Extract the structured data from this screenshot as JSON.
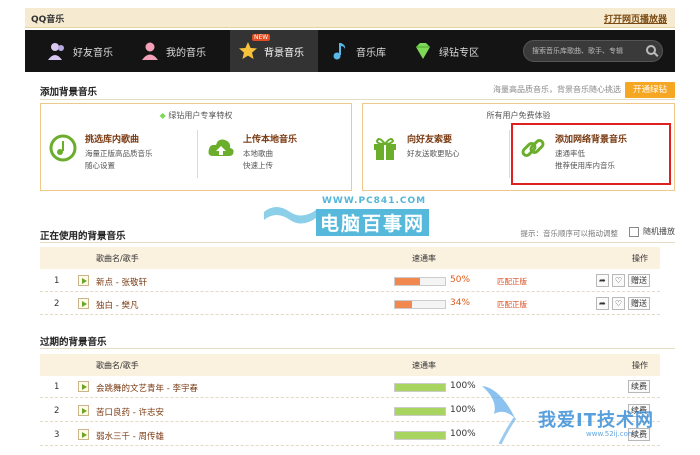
{
  "window": {
    "title": "QQ音乐",
    "open_web_player": "打开网页播放器"
  },
  "nav": {
    "items": [
      {
        "label": "好友音乐",
        "icon": "friends-icon"
      },
      {
        "label": "我的音乐",
        "icon": "person-icon"
      },
      {
        "label": "背景音乐",
        "icon": "star-icon",
        "badge": "NEW",
        "active": true
      },
      {
        "label": "音乐库",
        "icon": "note-icon"
      },
      {
        "label": "绿钻专区",
        "icon": "diamond-icon"
      }
    ],
    "search_placeholder": "搜索音乐库歌曲、歌手、专辑"
  },
  "add_bg": {
    "title": "添加背景音乐",
    "promo": "海量高品质音乐，背景音乐随心挑选",
    "open_btn": "开通绿钻",
    "vip_panel": {
      "header": "绿钻用户专享特权",
      "features": [
        {
          "title": "挑选库内歌曲",
          "lines": [
            "海量正版高品质音乐",
            "随心设置"
          ]
        },
        {
          "title": "上传本地音乐",
          "lines": [
            "本地歌曲",
            "快速上传"
          ]
        }
      ]
    },
    "free_panel": {
      "header": "所有用户免费体验",
      "features": [
        {
          "title": "向好友索要",
          "lines": [
            "好友送歌更贴心"
          ]
        },
        {
          "title": "添加网络背景音乐",
          "lines": [
            "速通率低",
            "推荐使用库内音乐"
          ]
        }
      ]
    }
  },
  "watermark1": {
    "site": "WWW.PC841.COM",
    "text": "电脑百事网"
  },
  "in_use": {
    "title": "正在使用的背景音乐",
    "tip": "提示：音乐顺序可以拖动调整",
    "shuffle": "随机播放",
    "headers": {
      "song": "歌曲名/歌手",
      "rate": "速通率",
      "ops": "操作"
    },
    "rows": [
      {
        "num": "1",
        "song": "新点 - 张敬轩",
        "rate": 50,
        "rate_text": "50%",
        "match": "匹配正版",
        "ops": [
          "分享",
          "收藏",
          "赠送"
        ]
      },
      {
        "num": "2",
        "song": "独白 - 樊凡",
        "rate": 34,
        "rate_text": "34%",
        "match": "匹配正版",
        "ops": [
          "分享",
          "收藏",
          "赠送"
        ]
      }
    ]
  },
  "expired": {
    "title": "过期的背景音乐",
    "headers": {
      "song": "歌曲名/歌手",
      "rate": "速通率",
      "ops": "操作"
    },
    "rows": [
      {
        "num": "1",
        "song": "会跳舞的文艺青年 - 李宇春",
        "rate": 100,
        "rate_text": "100%",
        "op": "续费"
      },
      {
        "num": "2",
        "song": "苦口良药 - 许志安",
        "rate": 100,
        "rate_text": "100%",
        "op": "续费"
      },
      {
        "num": "3",
        "song": "弱水三千 - 周传雄",
        "rate": 100,
        "rate_text": "100%",
        "op": "续费"
      }
    ]
  },
  "watermark2": {
    "text": "我爱IT技术网",
    "site": "www.52ij.com"
  },
  "colors": {
    "accent": "#f5a623",
    "match_red": "#d94c1f",
    "bar_orange": "#f08850",
    "bar_green": "#a8d460",
    "nav_bg": "#141414"
  }
}
